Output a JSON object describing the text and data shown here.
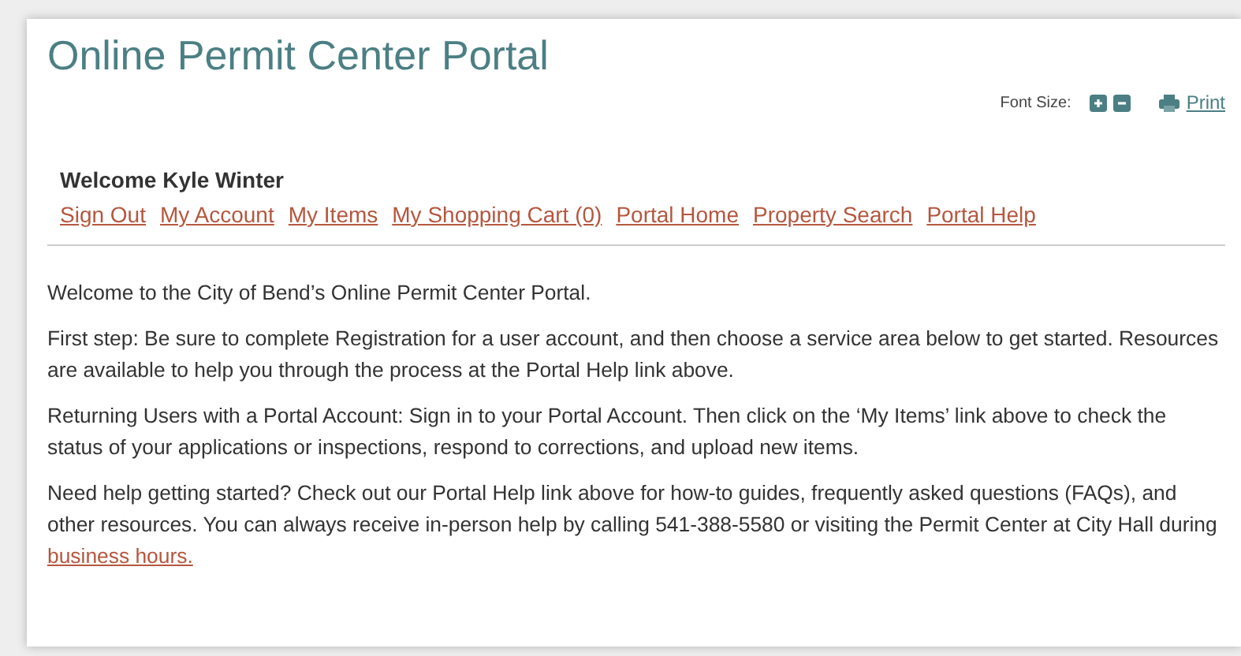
{
  "title": "Online Permit Center Portal",
  "tools": {
    "font_size_label": "Font Size:",
    "print": "Print"
  },
  "welcome": "Welcome Kyle Winter",
  "nav": [
    "Sign Out",
    "My Account",
    "My Items",
    "My Shopping Cart (0)",
    "Portal Home",
    "Property Search",
    "Portal Help"
  ],
  "paragraphs": [
    {
      "text": "Welcome to the City of Bend’s Online Permit Center Portal."
    },
    {
      "text": "First step: Be sure to complete Registration for a user account, and then choose a service area below to get started. Resources are available to help you through the process at the Portal Help link above."
    },
    {
      "text": "Returning Users with a Portal Account: Sign in to your Portal Account. Then click on the ‘My Items’ link above to check the status of your applications or inspections, respond to corrections, and upload new items."
    },
    {
      "text": "Need help getting started? Check out our Portal Help link above for how-to guides, frequently asked questions (FAQs), and other resources. You can always receive in-person help by calling 541-388-5580 or visiting the Permit Center at City Hall during ",
      "link": "business hours."
    }
  ]
}
